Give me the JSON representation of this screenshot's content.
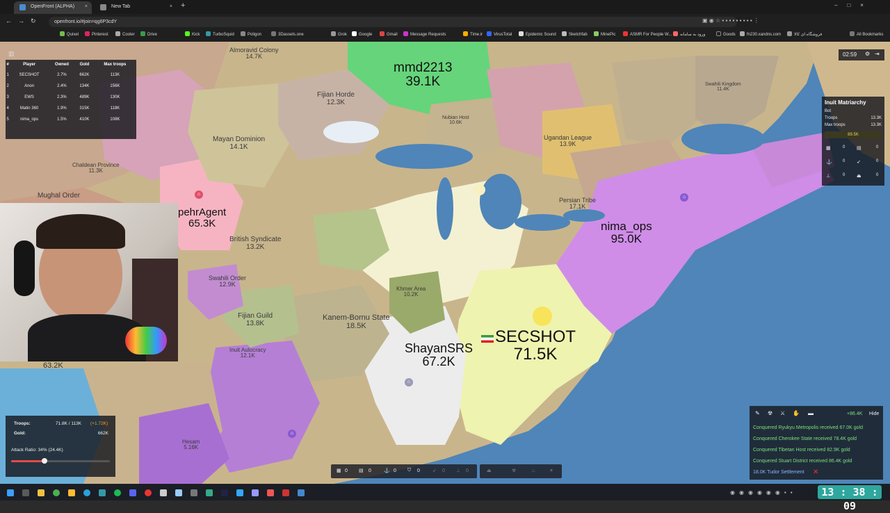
{
  "browser": {
    "tabs": [
      {
        "label": "OpenFront (ALPHA)",
        "active": true
      },
      {
        "label": "New Tab",
        "active": false
      }
    ],
    "url": "openfront.io/#join=qg6P3cdY",
    "bookmarks": [
      "Quixel",
      "Pinterest",
      "Cooler",
      "Drive",
      "Kick",
      "TurboSquid",
      "Poligon",
      "3Dassets.one",
      "Grok",
      "Google",
      "Gmail",
      "Message Requests",
      "Time.ir",
      "VirusTotal",
      "Epidemic Sound",
      "Sketchfab",
      "MinePic",
      "ASMR For People W...",
      "ورود به سامانه",
      "Goods",
      "fn230.xandns.com",
      "فروشگاه ای کالا",
      "All Bookmarks"
    ]
  },
  "leaderboard": {
    "headers": [
      "#",
      "Player",
      "Owned",
      "Gold",
      "Max troops"
    ],
    "rows": [
      [
        "1",
        "SECSHOT",
        "2.7%",
        "662K",
        "113K"
      ],
      [
        "2",
        "Anon",
        "2.4%",
        "134K",
        "156K"
      ],
      [
        "3",
        "EWS",
        "2.3%",
        "489K",
        "130K"
      ],
      [
        "4",
        "Matin 360",
        "1.9%",
        "315K",
        "118K"
      ],
      [
        "5",
        "nima_ops",
        "1.5%",
        "410K",
        "108K"
      ]
    ]
  },
  "timer": "02:59",
  "inspect": {
    "title": "Inuit Matriarchy",
    "type": "Bot",
    "troops_label": "Troops",
    "troops": "13.3K",
    "max_label": "Max troops",
    "max": "13.3K",
    "gold": "89.5K",
    "stats": [
      "0",
      "0",
      "0",
      "0",
      "0",
      "0"
    ]
  },
  "map_labels": [
    {
      "name": "Almoravid Colony",
      "value": "14.7K"
    },
    {
      "name": "mmd2213",
      "value": "39.1K"
    },
    {
      "name": "Fijian Horde",
      "value": "12.3K"
    },
    {
      "name": "Nubian Host",
      "value": "10.6K"
    },
    {
      "name": "Ugandan League",
      "value": "13.9K"
    },
    {
      "name": "Swahili Kingdom",
      "value": "11.4K"
    },
    {
      "name": "Mayan Dominion",
      "value": "14.1K"
    },
    {
      "name": "Chaldean Province",
      "value": "11.3K"
    },
    {
      "name": "Mughal Order",
      "value": ""
    },
    {
      "name": "pehrAgent",
      "value": "65.3K"
    },
    {
      "name": "British Syndicate",
      "value": "13.2K"
    },
    {
      "name": "Persian Tribe",
      "value": "17.1K"
    },
    {
      "name": "nima_ops",
      "value": "95.0K"
    },
    {
      "name": "Swahili Order",
      "value": "12.9K"
    },
    {
      "name": "Khmer Area",
      "value": "10.2K"
    },
    {
      "name": "Fijian Guild",
      "value": "13.8K"
    },
    {
      "name": "Kanem-Bornu State",
      "value": "18.5K"
    },
    {
      "name": "SECSHOT",
      "value": "71.5K"
    },
    {
      "name": "ShayanSRS",
      "value": "67.2K"
    },
    {
      "name": "Inuit Autocracy",
      "value": "12.1K"
    },
    {
      "name": "Hesam",
      "value": "5.16K"
    }
  ],
  "status": {
    "troops_label": "Troops:",
    "troops": "71.8K / 113K",
    "troops_rate": "(+1.72K)",
    "gold_label": "Gold:",
    "gold": "662K",
    "attack_ratio": "Attack Ratio: 34% (24.4K)",
    "attack_fraction": 0.34
  },
  "toolbar": {
    "counts": [
      "0",
      "0",
      "0",
      "0",
      "0",
      "0",
      "0",
      "0"
    ]
  },
  "events": {
    "gold_delta": "+86.4K",
    "hide": "Hide",
    "messages": [
      "Conquered Ryukyu Metropolis received 67.0K gold",
      "Conquered Cherokee State received 78.4K gold",
      "Conquered Tibetan Host received 82.9K gold",
      "Conquered Stuart District received 86.4K gold",
      "18.0K Tudor Settlement"
    ]
  },
  "clock": "13 : 38 : 09",
  "webcam_overlay": "63.2K"
}
